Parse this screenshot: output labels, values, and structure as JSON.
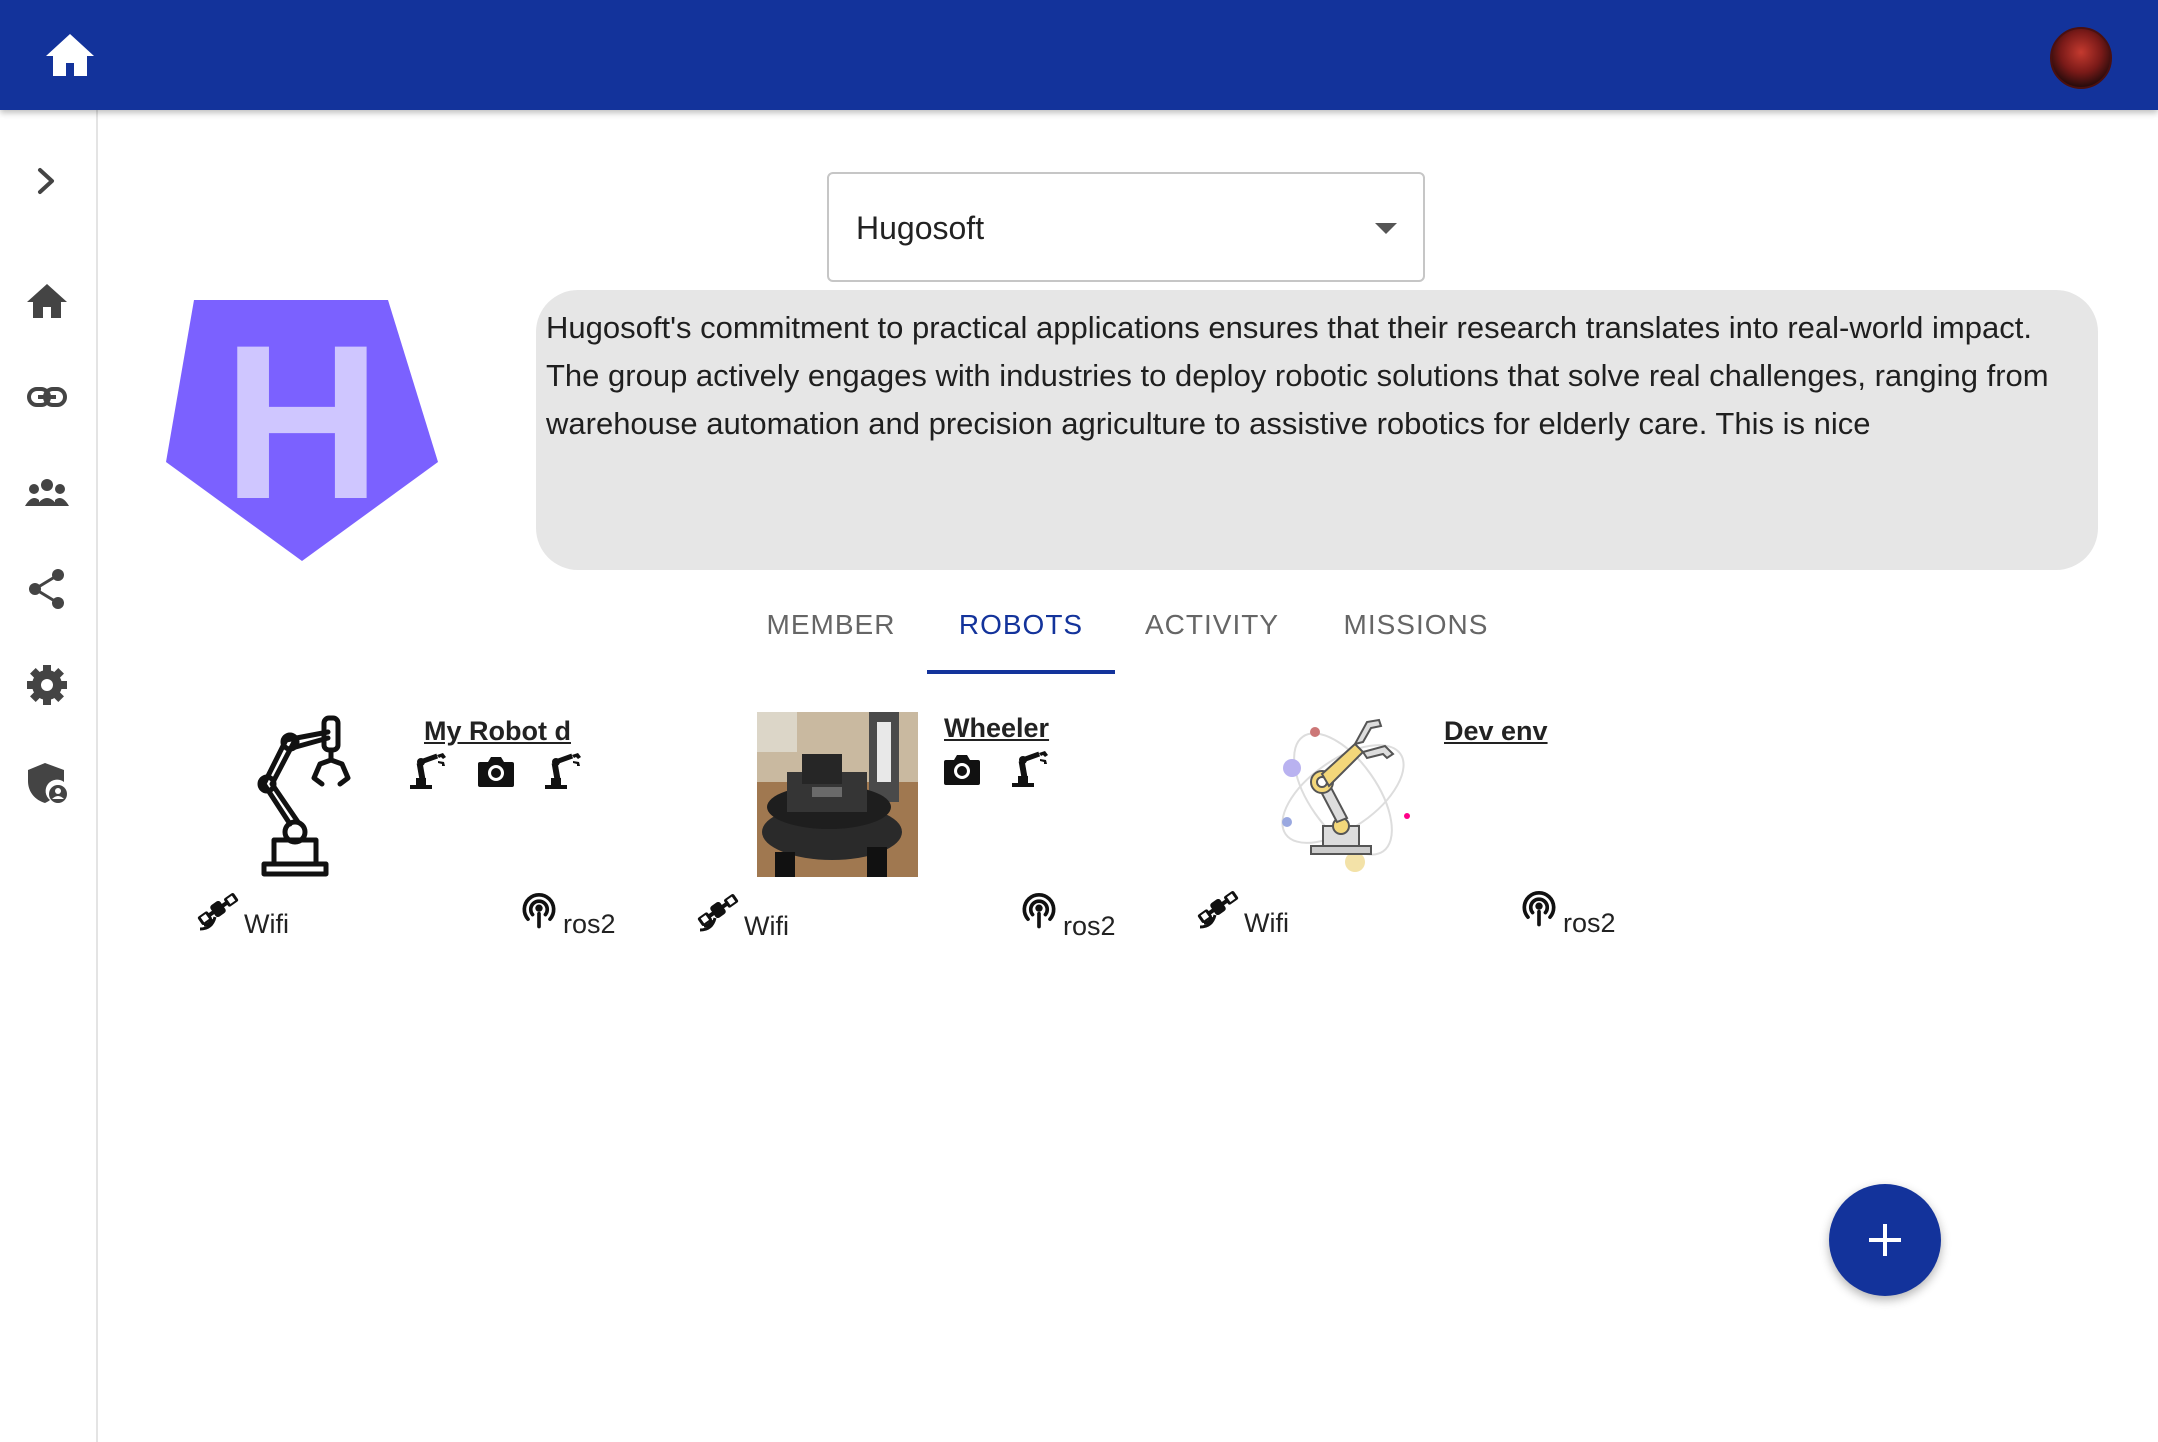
{
  "header": {
    "home_icon": "home-icon",
    "avatar": "user-avatar"
  },
  "sidebar": {
    "items": [
      {
        "name": "expand",
        "icon": "chevron-right-icon"
      },
      {
        "name": "home",
        "icon": "home-icon"
      },
      {
        "name": "links",
        "icon": "link-icon"
      },
      {
        "name": "groups",
        "icon": "groups-icon"
      },
      {
        "name": "share",
        "icon": "share-icon"
      },
      {
        "name": "settings",
        "icon": "gear-icon"
      },
      {
        "name": "admin",
        "icon": "admin-shield-icon"
      }
    ]
  },
  "org": {
    "selected": "Hugosoft",
    "description": "Hugosoft's commitment to practical applications ensures that their research translates into real-world impact. The group actively engages with industries to deploy robotic solutions that solve real challenges, ranging from warehouse automation and precision agriculture to assistive robotics for elderly care. This is nice",
    "logo_letter": "H",
    "logo_color": "#7b61ff"
  },
  "tabs": [
    {
      "label": "MEMBER",
      "active": false
    },
    {
      "label": "ROBOTS",
      "active": true
    },
    {
      "label": "ACTIVITY",
      "active": false
    },
    {
      "label": "MISSIONS",
      "active": false
    }
  ],
  "robots": [
    {
      "name": "My Robot d",
      "capabilities": [
        "robot-arm-icon",
        "camera-icon",
        "robot-arm-icon"
      ],
      "connection": "Wifi",
      "middleware": "ros2"
    },
    {
      "name": "Wheeler",
      "capabilities": [
        "camera-icon",
        "robot-arm-icon"
      ],
      "connection": "Wifi",
      "middleware": "ros2"
    },
    {
      "name": "Dev env",
      "capabilities": [],
      "connection": "Wifi",
      "middleware": "ros2"
    }
  ],
  "fab": {
    "icon": "plus-icon"
  },
  "colors": {
    "primary": "#13339b",
    "description_bg": "#e6e6e6"
  }
}
